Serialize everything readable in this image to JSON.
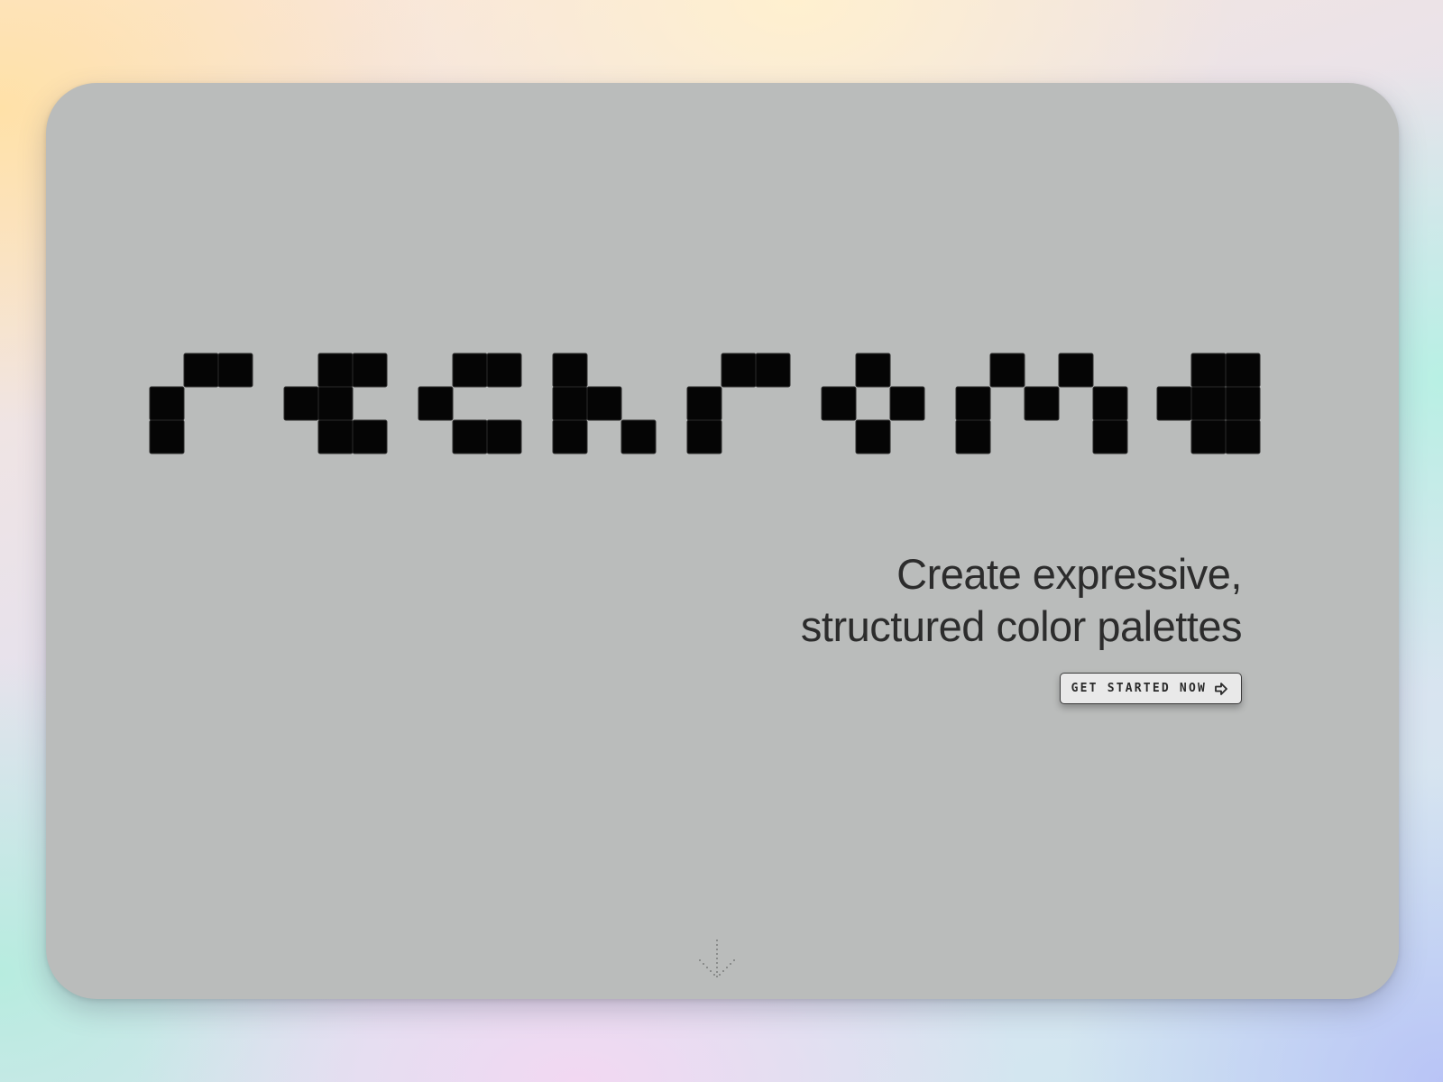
{
  "brand": {
    "name": "rechroma",
    "logo_color": "#050505"
  },
  "hero": {
    "tagline_line1": "Create expressive,",
    "tagline_line2": "structured color palettes",
    "cta_label": "GET STARTED NOW",
    "cta_icon": "arrow-right-icon",
    "scroll_icon": "arrow-down-icon"
  },
  "colors": {
    "card_bg": "#babcbb",
    "text": "#2c2c2c",
    "button_bg": "#e9e9e9"
  }
}
